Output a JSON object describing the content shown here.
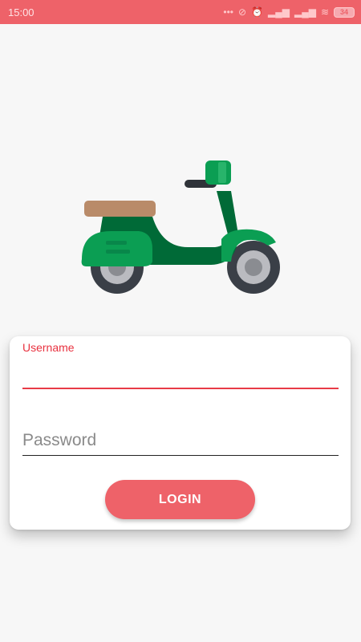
{
  "status_bar": {
    "time": "15:00",
    "icons": [
      "more-icon",
      "alarm-off-icon",
      "alarm-icon",
      "signal-icon",
      "signal-icon",
      "wifi-icon"
    ],
    "battery": "34"
  },
  "hero": {
    "icon": "scooter-icon"
  },
  "login_card": {
    "username_label": "Username",
    "username_value": "",
    "password_placeholder": "Password",
    "login_label": "LOGIN"
  },
  "colors": {
    "accent": "#ee6269",
    "label_red": "#e8313f",
    "scooter_green": "#0b9e53",
    "scooter_dark_green": "#006a37",
    "seat": "#b98b69"
  }
}
